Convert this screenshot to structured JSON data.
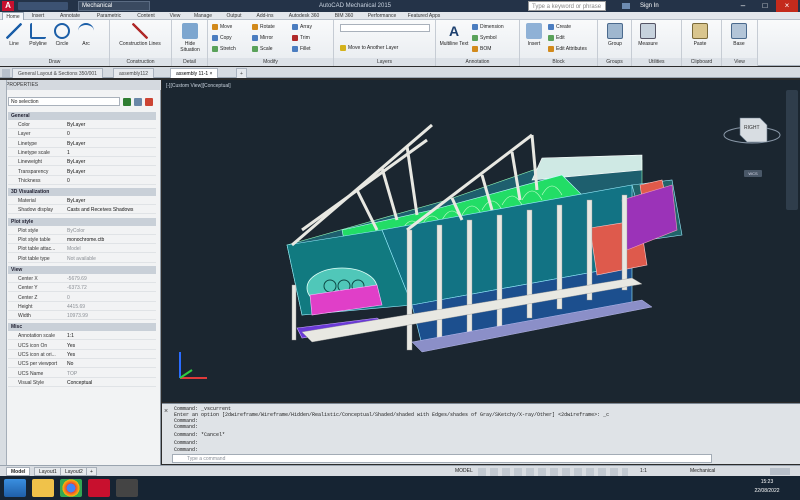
{
  "titlebar": {
    "workspace": "Mechanical",
    "title": "AutoCAD Mechanical 2015",
    "search_placeholder": "Type a keyword or phrase",
    "signin": "Sign In"
  },
  "ribbon_tabs": [
    "Home",
    "Insert",
    "Annotate",
    "Parametric",
    "Content",
    "View",
    "Manage",
    "Output",
    "Add-ins",
    "Autodesk 360",
    "BIM 360",
    "Performance",
    "Featured Apps"
  ],
  "ribbon": {
    "draw": {
      "label": "Draw",
      "line": "Line",
      "polyline": "Polyline",
      "circle": "Circle",
      "arc": "Arc"
    },
    "construction": {
      "label": "Construction",
      "lines": "Construction Lines"
    },
    "detail": {
      "label": "Detail",
      "hide": "Hide Situation"
    },
    "modify": {
      "label": "Modify",
      "move": "Move",
      "copy": "Copy",
      "stretch": "Stretch",
      "rotate": "Rotate",
      "mirror": "Mirror",
      "scale": "Scale",
      "array": "Array",
      "trim": "Trim",
      "fillet": "Fillet"
    },
    "layers": {
      "label": "Layers",
      "move_layer": "Move to Another Layer"
    },
    "annotation": {
      "label": "Annotation",
      "multiline": "Multiline Text",
      "dimension": "Dimension",
      "symbol": "Symbol",
      "bom": "BOM"
    },
    "block": {
      "label": "Block",
      "insert": "Insert",
      "create": "Create",
      "edit": "Edit",
      "edit_attr": "Edit Attributes"
    },
    "groups": {
      "label": "Groups",
      "group": "Group"
    },
    "utilities": {
      "label": "Utilities",
      "measure": "Measure"
    },
    "clipboard": {
      "label": "Clipboard",
      "paste": "Paste"
    },
    "view": {
      "label": "View",
      "base": "Base"
    }
  },
  "doctabs": [
    "General Layout & Sections 350/001",
    "assembly112",
    "assembly 11-1"
  ],
  "properties": {
    "header": "PROPERTIES",
    "selection": "No selection",
    "general": {
      "title": "General",
      "rows": [
        [
          "Color",
          "ByLayer"
        ],
        [
          "Layer",
          "0"
        ],
        [
          "Linetype",
          "ByLayer"
        ],
        [
          "Linetype scale",
          "1"
        ],
        [
          "Lineweight",
          "ByLayer"
        ],
        [
          "Transparency",
          "ByLayer"
        ],
        [
          "Thickness",
          "0"
        ]
      ]
    },
    "viz": {
      "title": "3D Visualization",
      "rows": [
        [
          "Material",
          "ByLayer"
        ],
        [
          "Shadow display",
          "Casts and Receives Shadows"
        ]
      ]
    },
    "plot": {
      "title": "Plot style",
      "rows": [
        [
          "Plot style",
          "ByColor"
        ],
        [
          "Plot style table",
          "monochrome.ctb"
        ],
        [
          "Plot table attac...",
          "Model"
        ],
        [
          "Plot table type",
          "Not available"
        ]
      ]
    },
    "view": {
      "title": "View",
      "rows": [
        [
          "Center X",
          "-5679.69"
        ],
        [
          "Center Y",
          "-6373.72"
        ],
        [
          "Center Z",
          "0"
        ],
        [
          "Height",
          "4415.69"
        ],
        [
          "Width",
          "10973.99"
        ]
      ]
    },
    "misc": {
      "title": "Misc",
      "rows": [
        [
          "Annotation scale",
          "1:1"
        ],
        [
          "UCS icon On",
          "Yes"
        ],
        [
          "UCS icon at ori...",
          "Yes"
        ],
        [
          "UCS per viewport",
          "No"
        ],
        [
          "UCS Name",
          "TOP"
        ],
        [
          "Visual Style",
          "Conceptual"
        ]
      ]
    }
  },
  "viewport": {
    "label": "[-][Custom View][Conceptual]",
    "cube_face": "RIGHT",
    "wcs": "WCS"
  },
  "command": {
    "lines": [
      "Command: _vscurrent",
      "Enter an option [2dwireframe/Wireframe/Hidden/Realistic/Conceptual/Shaded/shaded with Edges/shades of Gray/SKetchy/X-ray/Other] <2dwireframe>: _c",
      "Command:",
      "Command:",
      "Command: *Cancel*",
      "Command:",
      "Command:"
    ],
    "placeholder": "Type a command"
  },
  "statusbar": {
    "tabs": [
      "Model",
      "Layout1",
      "Layout2"
    ],
    "model": "MODEL",
    "scale": "1:1",
    "workspace": "Mechanical"
  },
  "taskbar": {
    "time": "15:23",
    "date": "22/08/2022"
  }
}
